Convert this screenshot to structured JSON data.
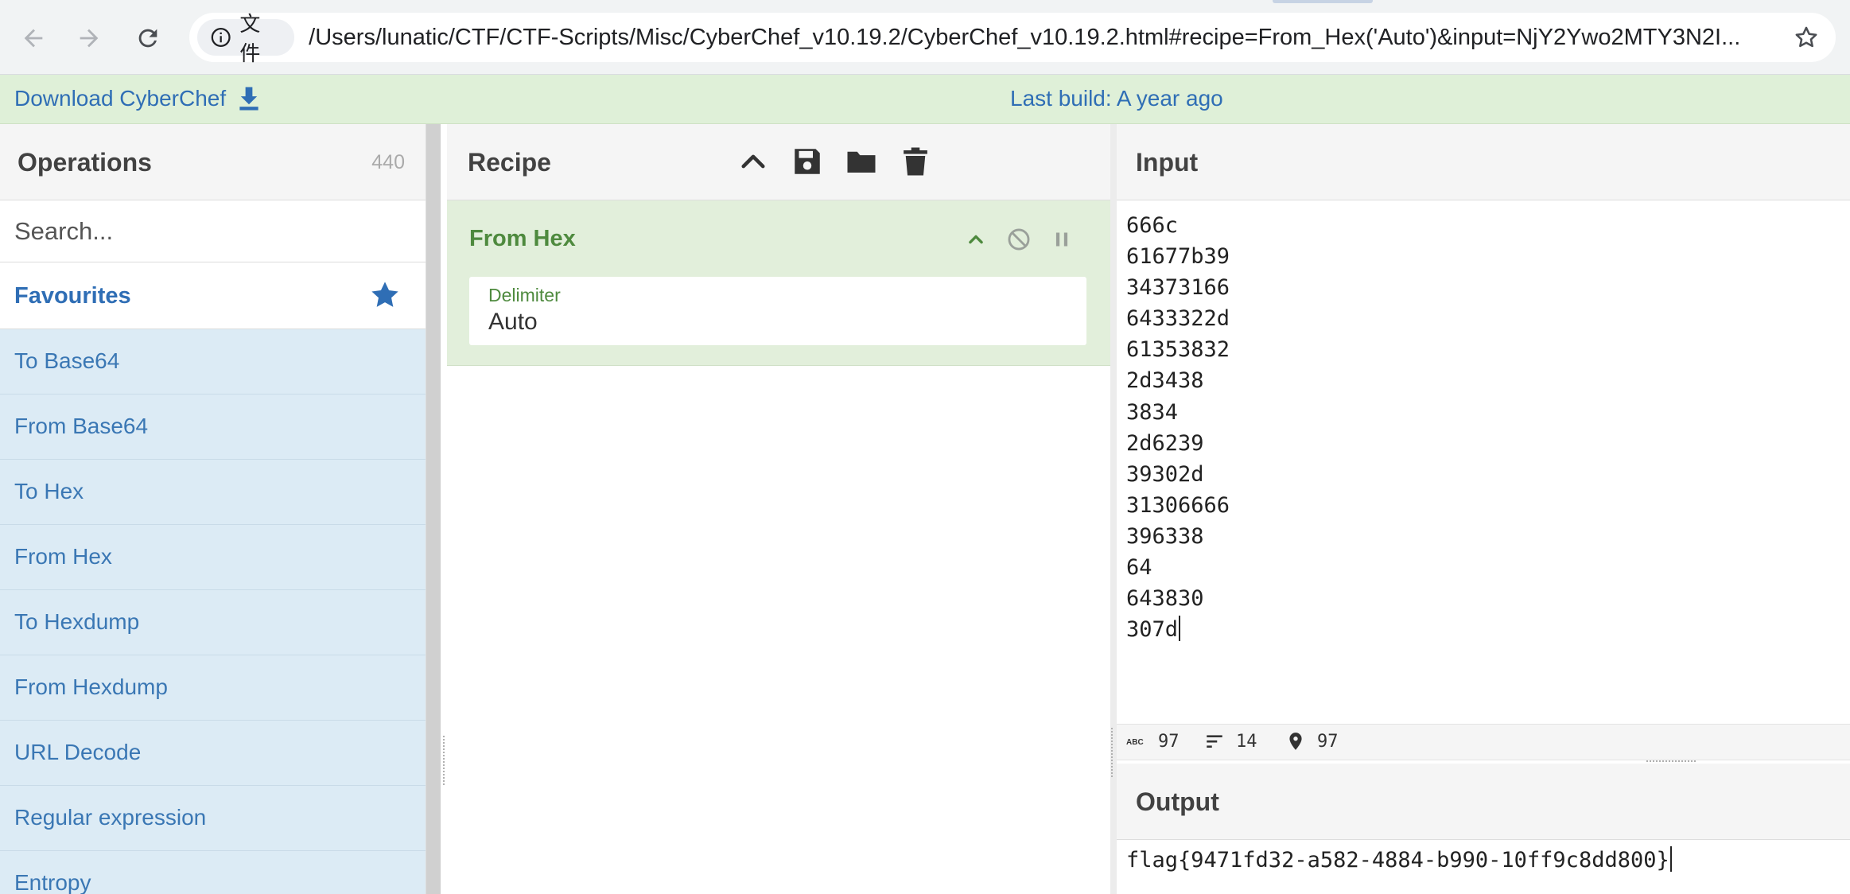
{
  "browser": {
    "site_chip_label": "文件",
    "url": "/Users/lunatic/CTF/CTF-Scripts/Misc/CyberChef_v10.19.2/CyberChef_v10.19.2.html#recipe=From_Hex('Auto')&input=NjY2Ywo2MTY3N2I..."
  },
  "banner": {
    "download_label": "Download CyberChef",
    "build_label": "Last build: A year ago"
  },
  "operations": {
    "title": "Operations",
    "count": "440",
    "search_placeholder": "Search...",
    "favourites_label": "Favourites",
    "items": [
      {
        "label": "To Base64"
      },
      {
        "label": "From Base64"
      },
      {
        "label": "To Hex"
      },
      {
        "label": "From Hex"
      },
      {
        "label": "To Hexdump"
      },
      {
        "label": "From Hexdump"
      },
      {
        "label": "URL Decode"
      },
      {
        "label": "Regular expression"
      },
      {
        "label": "Entropy"
      }
    ]
  },
  "recipe": {
    "title": "Recipe",
    "operation": {
      "name": "From Hex",
      "arg_label": "Delimiter",
      "arg_value": "Auto"
    }
  },
  "input": {
    "title": "Input",
    "lines": [
      "666c",
      "61677b39",
      "34373166",
      "6433322d",
      "61353832",
      "2d3438",
      "3834",
      "2d6239",
      "39302d",
      "31306666",
      "396338",
      "64",
      "643830",
      "307d"
    ],
    "stats": {
      "length": "97",
      "lines": "14",
      "position": "97"
    }
  },
  "output": {
    "title": "Output",
    "text": "flag{9471fd32-a582-4884-b990-10ff9c8dd800}"
  },
  "colors": {
    "banner_bg": "#dff0d8",
    "link_blue": "#2f6eb5",
    "recipe_green": "#4e8a3e",
    "recipe_op_bg": "#e2efdb",
    "op_item_bg": "#dcebf5"
  },
  "icons": {
    "nav": [
      "back-arrow-icon",
      "forward-arrow-icon",
      "reload-icon"
    ],
    "recipe_header": [
      "chevron-up-icon",
      "save-icon",
      "folder-icon",
      "trash-icon"
    ],
    "recipe_op": [
      "chevron-up-icon",
      "disable-icon",
      "pause-icon"
    ],
    "status": [
      "abc-icon",
      "lines-icon",
      "location-pin-icon"
    ]
  }
}
